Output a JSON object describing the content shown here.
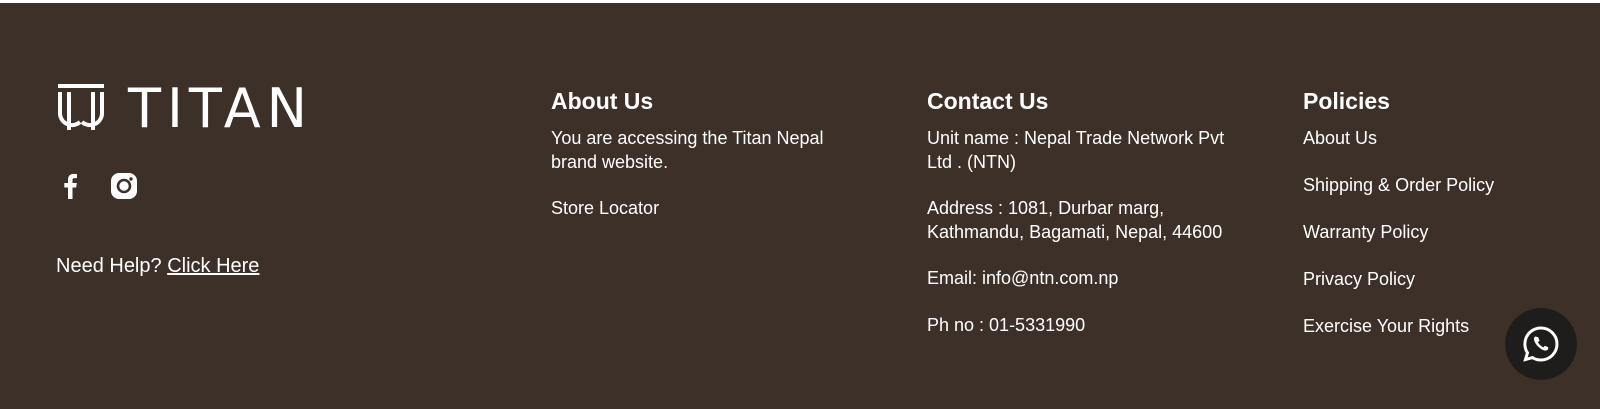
{
  "brand": {
    "name": "TITAN"
  },
  "socials": [
    {
      "icon": "facebook-icon"
    },
    {
      "icon": "instagram-icon"
    }
  ],
  "help": {
    "prefix": "Need Help?",
    "link": "Click Here"
  },
  "about": {
    "heading": "About Us",
    "text": "You are accessing the Titan Nepal brand website.",
    "link": "Store Locator"
  },
  "contact": {
    "heading": "Contact Us",
    "unit": "Unit name : Nepal Trade Network Pvt Ltd . (NTN)",
    "address": "Address : 1081, Durbar marg, Kathmandu, Bagamati, Nepal, 44600",
    "email": "Email: info@ntn.com.np",
    "phone": "Ph no : 01-5331990"
  },
  "policies": {
    "heading": "Policies",
    "links": [
      "About Us",
      "Shipping & Order Policy",
      "Warranty Policy",
      "Privacy Policy",
      "Exercise Your Rights"
    ]
  },
  "colors": {
    "footer_bg": "#3d3029",
    "text": "#ffffff",
    "chat_bg": "#1f1d1c"
  },
  "chat": {
    "icon": "whatsapp-icon"
  }
}
